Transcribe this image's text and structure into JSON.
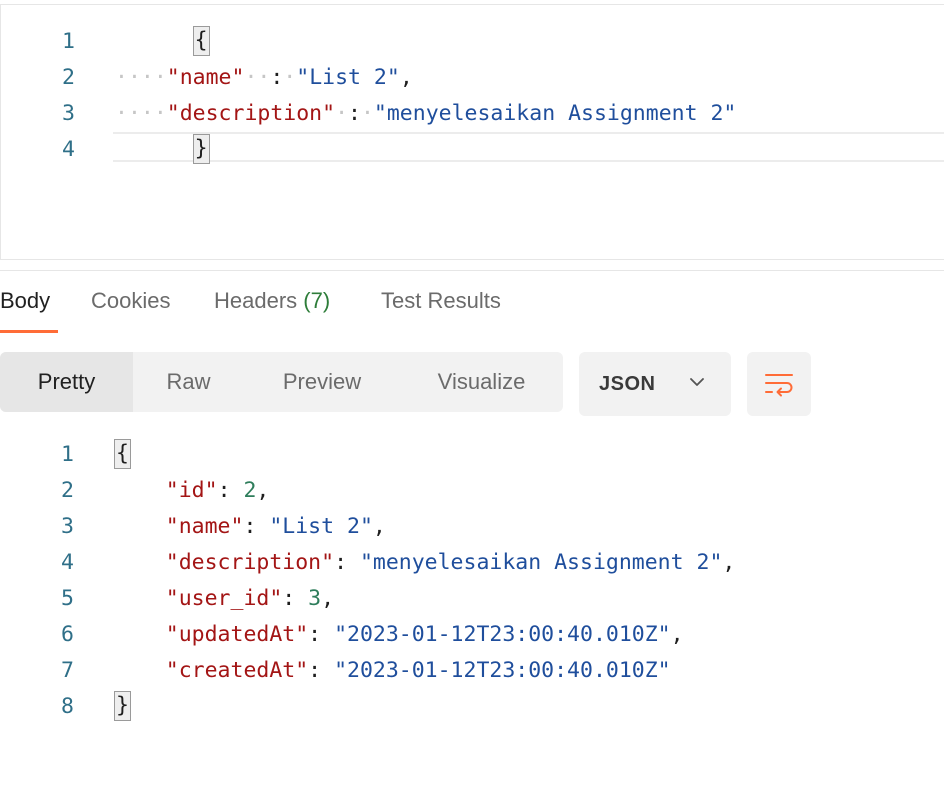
{
  "request_body": {
    "lines": [
      {
        "no": "1"
      },
      {
        "no": "2",
        "key": "\"name\"",
        "colon": ":",
        "value": "\"List 2\"",
        "comma": ","
      },
      {
        "no": "3",
        "key": "\"description\"",
        "colon": ":",
        "value": "\"menyelesaikan Assignment 2\""
      },
      {
        "no": "4"
      }
    ],
    "open_brace": "{",
    "close_brace": "}"
  },
  "response_tabs": {
    "body": "Body",
    "cookies": "Cookies",
    "headers": "Headers",
    "headers_count": "(7)",
    "test_results": "Test Results"
  },
  "view_modes": {
    "pretty": "Pretty",
    "raw": "Raw",
    "preview": "Preview",
    "visualize": "Visualize"
  },
  "format": {
    "selected": "JSON"
  },
  "icons": {
    "chevron": "chevron-down-icon",
    "wrap": "wrap-lines-icon"
  },
  "colors": {
    "accent": "#ff6c37",
    "key": "#a31515",
    "string": "#1f4e9c",
    "number": "#2e7d5b",
    "line_number": "#2f6f88"
  },
  "response_body": {
    "open_brace": "{",
    "close_brace": "}",
    "line_numbers": [
      "1",
      "2",
      "3",
      "4",
      "5",
      "6",
      "7",
      "8"
    ],
    "fields": [
      {
        "key": "\"id\"",
        "value": "2",
        "type": "num",
        "comma": ","
      },
      {
        "key": "\"name\"",
        "value": "\"List 2\"",
        "type": "str",
        "comma": ","
      },
      {
        "key": "\"description\"",
        "value": "\"menyelesaikan Assignment 2\"",
        "type": "str",
        "comma": ","
      },
      {
        "key": "\"user_id\"",
        "value": "3",
        "type": "num",
        "comma": ","
      },
      {
        "key": "\"updatedAt\"",
        "value": "\"2023-01-12T23:00:40.010Z\"",
        "type": "str",
        "comma": ","
      },
      {
        "key": "\"createdAt\"",
        "value": "\"2023-01-12T23:00:40.010Z\"",
        "type": "str",
        "comma": ""
      }
    ]
  }
}
